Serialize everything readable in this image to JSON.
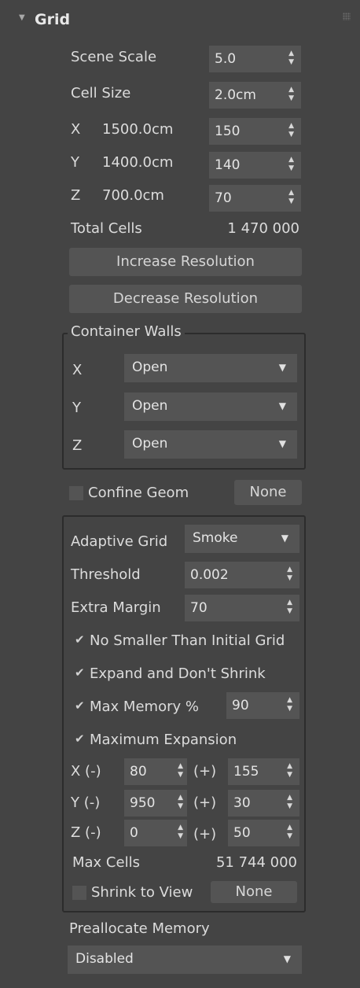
{
  "rollout": {
    "title": "Grid"
  },
  "scene_scale": {
    "label": "Scene Scale",
    "value": "5.0"
  },
  "cell_size": {
    "label": "Cell Size",
    "value": "2.0cm"
  },
  "axes": [
    {
      "axis": "X",
      "size": "1500.0cm",
      "cells": "150"
    },
    {
      "axis": "Y",
      "size": "1400.0cm",
      "cells": "140"
    },
    {
      "axis": "Z",
      "size": "700.0cm",
      "cells": "70"
    }
  ],
  "total_cells": {
    "label": "Total Cells",
    "value": "1 470 000"
  },
  "buttons": {
    "increase": "Increase Resolution",
    "decrease": "Decrease Resolution"
  },
  "container_walls": {
    "title": "Container Walls",
    "rows": [
      {
        "axis": "X",
        "value": "Open"
      },
      {
        "axis": "Y",
        "value": "Open"
      },
      {
        "axis": "Z",
        "value": "Open"
      }
    ]
  },
  "confine_geom": {
    "label": "Confine Geom",
    "checked": false,
    "button": "None"
  },
  "adaptive": {
    "label": "Adaptive Grid",
    "value": "Smoke",
    "threshold_label": "Threshold",
    "threshold": "0.002",
    "extra_margin_label": "Extra Margin",
    "extra_margin": "70",
    "no_smaller_label": "No Smaller Than Initial Grid",
    "expand_label": "Expand and Don't Shrink",
    "max_memory_label": "Max Memory %",
    "max_memory": "90",
    "max_expansion_label": "Maximum Expansion",
    "expansion": [
      {
        "minus_label": "X (-)",
        "minus": "80",
        "plus_label": "(+)",
        "plus": "155"
      },
      {
        "minus_label": "Y (-)",
        "minus": "950",
        "plus_label": "(+)",
        "plus": "30"
      },
      {
        "minus_label": "Z (-)",
        "minus": "0",
        "plus_label": "(+)",
        "plus": "50"
      }
    ],
    "max_cells_label": "Max Cells",
    "max_cells": "51 744 000",
    "shrink_label": "Shrink to View",
    "shrink_button": "None"
  },
  "preallocate": {
    "label": "Preallocate Memory",
    "value": "Disabled"
  },
  "colors": {
    "panel_bg": "#444444",
    "field_bg": "#545454",
    "group_border": "#2c2c2c",
    "text": "#dcdcdc"
  }
}
